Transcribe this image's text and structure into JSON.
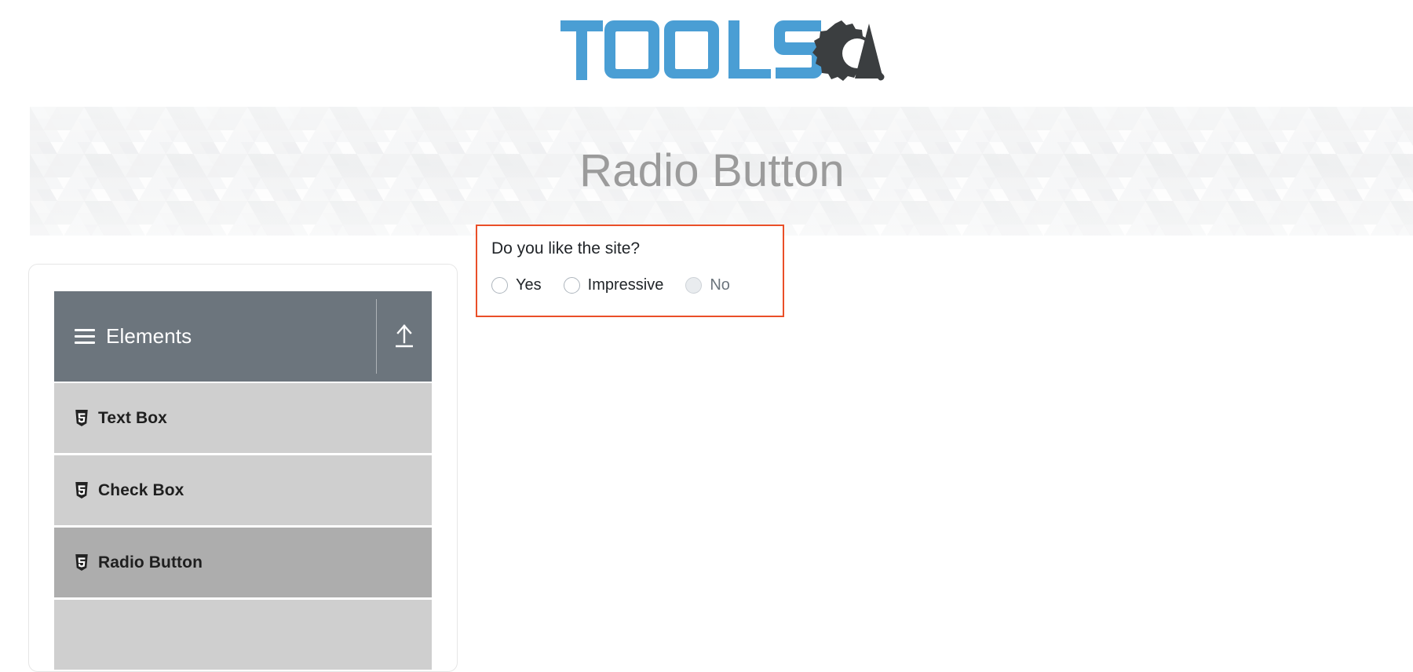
{
  "header": {
    "logo": {
      "text_primary": "TOOLS",
      "text_secondary": "A",
      "gear_icon": "gear-magnifier-icon",
      "primary_color": "#4a9ed4",
      "secondary_color": "#3b3e40"
    }
  },
  "banner": {
    "title": "Radio Button"
  },
  "sidebar": {
    "group": {
      "label": "Elements",
      "menu_icon": "hamburger-icon",
      "toggle_icon": "collapse-up-arrow-icon"
    },
    "items": [
      {
        "label": "Text Box",
        "icon": "html5-badge-icon",
        "active": false
      },
      {
        "label": "Check Box",
        "icon": "html5-badge-icon",
        "active": false
      },
      {
        "label": "Radio Button",
        "icon": "html5-badge-icon",
        "active": true
      },
      {
        "label": "",
        "icon": "html5-badge-icon",
        "active": false
      }
    ]
  },
  "main": {
    "highlight_color": "#ea4f28",
    "question": "Do you like the site?",
    "options": [
      {
        "label": "Yes",
        "selected": false,
        "disabled": false
      },
      {
        "label": "Impressive",
        "selected": false,
        "disabled": false
      },
      {
        "label": "No",
        "selected": false,
        "disabled": true
      }
    ]
  }
}
